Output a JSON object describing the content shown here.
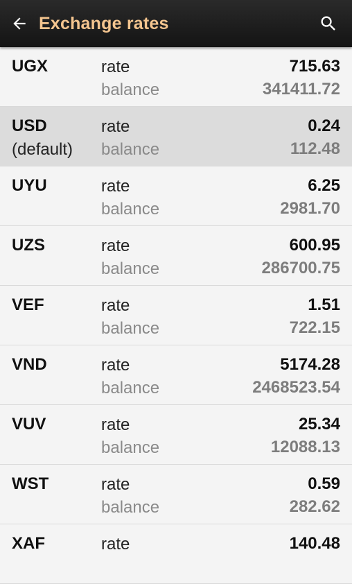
{
  "app_bar": {
    "title": "Exchange rates",
    "back_icon": "arrow-left-icon",
    "search_icon": "search-icon"
  },
  "labels": {
    "rate": "rate",
    "balance": "balance"
  },
  "currencies": [
    {
      "code": "UGX",
      "note": "",
      "rate": "715.63",
      "balance": "341411.72",
      "selected": false
    },
    {
      "code": "USD",
      "note": "(default)",
      "rate": "0.24",
      "balance": "112.48",
      "selected": true
    },
    {
      "code": "UYU",
      "note": "",
      "rate": "6.25",
      "balance": "2981.70",
      "selected": false
    },
    {
      "code": "UZS",
      "note": "",
      "rate": "600.95",
      "balance": "286700.75",
      "selected": false
    },
    {
      "code": "VEF",
      "note": "",
      "rate": "1.51",
      "balance": "722.15",
      "selected": false
    },
    {
      "code": "VND",
      "note": "",
      "rate": "5174.28",
      "balance": "2468523.54",
      "selected": false
    },
    {
      "code": "VUV",
      "note": "",
      "rate": "25.34",
      "balance": "12088.13",
      "selected": false
    },
    {
      "code": "WST",
      "note": "",
      "rate": "0.59",
      "balance": "282.62",
      "selected": false
    },
    {
      "code": "XAF",
      "note": "",
      "rate": "140.48",
      "balance": "",
      "selected": false
    }
  ],
  "colors": {
    "app_bar_bg": "#1c1c1c",
    "title": "#f4c58f",
    "row_bg": "#f4f4f4",
    "selected_row_bg": "#dcdcdc"
  }
}
